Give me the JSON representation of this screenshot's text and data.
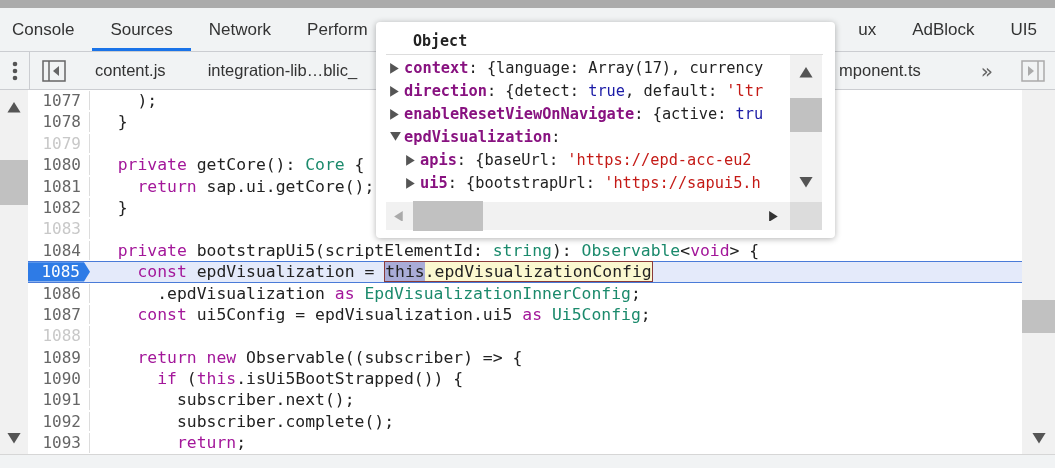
{
  "panel_tabs": {
    "left": [
      {
        "label": "Console",
        "selected": false
      },
      {
        "label": "Sources",
        "selected": true
      },
      {
        "label": "Network",
        "selected": false
      },
      {
        "label": "Perform",
        "selected": false
      }
    ],
    "right": [
      {
        "label": "ux",
        "selected": false
      },
      {
        "label": "AdBlock",
        "selected": false
      },
      {
        "label": "UI5",
        "selected": false
      }
    ]
  },
  "file_tabs": {
    "left": [
      "content.js",
      "integration-lib…blic_"
    ],
    "right": [
      "mponent.ts"
    ],
    "overflow": "»"
  },
  "lines": [
    {
      "number": "1077",
      "breakpoint": false,
      "current": false,
      "tokens": [
        {
          "kind": "plain",
          "text": "    );"
        }
      ]
    },
    {
      "number": "1078",
      "breakpoint": false,
      "current": false,
      "tokens": [
        {
          "kind": "plain",
          "text": "  }"
        }
      ]
    },
    {
      "number": "1079",
      "breakpoint": false,
      "current": false
    },
    {
      "number": "1080",
      "breakpoint": false,
      "current": false,
      "tokens": [
        {
          "kind": "keyword",
          "text": "  private"
        },
        {
          "kind": "plain",
          "text": " getCore(): "
        },
        {
          "kind": "type",
          "text": "Core"
        },
        {
          "kind": "plain",
          "text": " {"
        }
      ]
    },
    {
      "number": "1081",
      "breakpoint": false,
      "current": false,
      "tokens": [
        {
          "kind": "keyword",
          "text": "    return"
        },
        {
          "kind": "plain",
          "text": " sap.ui.getCore();"
        }
      ]
    },
    {
      "number": "1082",
      "breakpoint": false,
      "current": false,
      "tokens": [
        {
          "kind": "plain",
          "text": "  }"
        }
      ]
    },
    {
      "number": "1083",
      "breakpoint": false,
      "current": false
    },
    {
      "number": "1084",
      "breakpoint": false,
      "current": false,
      "tokens": [
        {
          "kind": "keyword",
          "text": "  private"
        },
        {
          "kind": "plain",
          "text": " bootstrapUi5(scriptElementId: "
        },
        {
          "kind": "type",
          "text": "string"
        },
        {
          "kind": "plain",
          "text": "): "
        },
        {
          "kind": "type",
          "text": "Observable"
        },
        {
          "kind": "plain",
          "text": "<"
        },
        {
          "kind": "keyword",
          "text": "void"
        },
        {
          "kind": "plain",
          "text": "> {"
        }
      ]
    },
    {
      "number": "1085",
      "breakpoint": true,
      "current": true,
      "tokens": [
        {
          "kind": "keyword",
          "text": "    const"
        },
        {
          "kind": "plain",
          "text": " epdVisualization = "
        },
        {
          "kind": "eval_head",
          "text": "this"
        },
        {
          "kind": "eval_tail",
          "text": ".epdVisualizationConfig"
        }
      ]
    },
    {
      "number": "1086",
      "breakpoint": false,
      "current": false,
      "tokens": [
        {
          "kind": "plain",
          "text": "      .epdVisualization "
        },
        {
          "kind": "keyword",
          "text": "as"
        },
        {
          "kind": "type",
          "text": " EpdVisualizationInnerConfig"
        },
        {
          "kind": "plain",
          "text": ";"
        }
      ]
    },
    {
      "number": "1087",
      "breakpoint": false,
      "current": false,
      "tokens": [
        {
          "kind": "keyword",
          "text": "    const"
        },
        {
          "kind": "plain",
          "text": " ui5Config = epdVisualization.ui5 "
        },
        {
          "kind": "keyword",
          "text": "as"
        },
        {
          "kind": "type",
          "text": " Ui5Config"
        },
        {
          "kind": "plain",
          "text": ";"
        }
      ]
    },
    {
      "number": "1088",
      "breakpoint": false,
      "current": false
    },
    {
      "number": "1089",
      "breakpoint": false,
      "current": false,
      "tokens": [
        {
          "kind": "keyword",
          "text": "    return"
        },
        {
          "kind": "keyword",
          "text": " new"
        },
        {
          "kind": "plain",
          "text": " Observable((subscriber) => {"
        }
      ]
    },
    {
      "number": "1090",
      "breakpoint": false,
      "current": false,
      "tokens": [
        {
          "kind": "keyword",
          "text": "      if"
        },
        {
          "kind": "plain",
          "text": " ("
        },
        {
          "kind": "keyword",
          "text": "this"
        },
        {
          "kind": "plain",
          "text": ".isUi5BootStrapped()) {"
        }
      ]
    },
    {
      "number": "1091",
      "breakpoint": false,
      "current": false,
      "tokens": [
        {
          "kind": "plain",
          "text": "        subscriber.next();"
        }
      ]
    },
    {
      "number": "1092",
      "breakpoint": false,
      "current": false,
      "tokens": [
        {
          "kind": "plain",
          "text": "        subscriber.complete();"
        }
      ]
    },
    {
      "number": "1093",
      "breakpoint": false,
      "current": false,
      "tokens": [
        {
          "kind": "keyword",
          "text": "        return"
        },
        {
          "kind": "plain",
          "text": ";"
        }
      ]
    }
  ],
  "popover": {
    "title": "Object",
    "properties": [
      {
        "key": "context",
        "expanded": false,
        "value": [
          {
            "kind": "plain",
            "text": ": {language: Array(17), currency"
          }
        ]
      },
      {
        "key": "direction",
        "expanded": false,
        "value": [
          {
            "kind": "plain",
            "text": ": {detect: "
          },
          {
            "kind": "literal",
            "text": "true"
          },
          {
            "kind": "plain",
            "text": ", default: "
          },
          {
            "kind": "string",
            "text": "'ltr"
          }
        ]
      },
      {
        "key": "enableResetViewOnNavigate",
        "expanded": false,
        "value": [
          {
            "kind": "plain",
            "text": ": {active: "
          },
          {
            "kind": "literal",
            "text": "tru"
          }
        ]
      },
      {
        "key": "epdVisualization",
        "expanded": true,
        "value": [
          {
            "kind": "plain",
            "text": ":"
          }
        ],
        "children": [
          {
            "key": "apis",
            "expanded": false,
            "value": [
              {
                "kind": "plain",
                "text": ": {baseUrl: "
              },
              {
                "kind": "string",
                "text": "'https://epd-acc-eu2"
              }
            ]
          },
          {
            "key": "ui5",
            "expanded": false,
            "value": [
              {
                "kind": "plain",
                "text": ": {bootstrapUrl: "
              },
              {
                "kind": "string",
                "text": "'https://sapui5.h"
              }
            ]
          }
        ]
      }
    ]
  }
}
